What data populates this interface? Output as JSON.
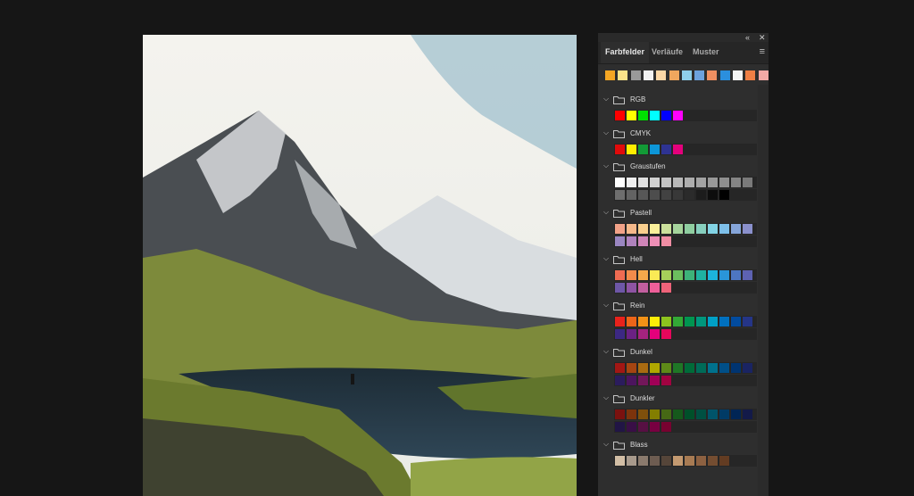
{
  "panel": {
    "collapse_glyph": "«",
    "close_glyph": "✕",
    "menu_glyph": "≡",
    "tabs": [
      {
        "label": "Farbfelder",
        "active": true
      },
      {
        "label": "Verläufe",
        "active": false
      },
      {
        "label": "Muster",
        "active": false
      }
    ],
    "recent": [
      "#f5a623",
      "#fbe38a",
      "#9a9a9a",
      "#f2f2f2",
      "#fbd7a6",
      "#f0a75e",
      "#8ecfea",
      "#6da2de",
      "#f19061",
      "#2b8fde",
      "#f5f5f5",
      "#ef7f45",
      "#f3a9a5"
    ],
    "groups": [
      {
        "name": "RGB",
        "rows": [
          [
            "#ff0000",
            "#ffff00",
            "#00e000",
            "#00ffff",
            "#0000ff",
            "#ff00ff"
          ]
        ]
      },
      {
        "name": "CMYK",
        "rows": [
          [
            "#e10b0b",
            "#ffed00",
            "#129a36",
            "#0d96d8",
            "#2e3393",
            "#e4007c"
          ]
        ]
      },
      {
        "name": "Graustufen",
        "rows": [
          [
            "#ffffff",
            "#f0f0f0",
            "#e0e0e0",
            "#d1d1d1",
            "#c4c4c4",
            "#b8b8b8",
            "#adadad",
            "#a3a3a3",
            "#999999",
            "#8f8f8f",
            "#858585",
            "#7a7a7a"
          ],
          [
            "#6e6e6e",
            "#636363",
            "#575757",
            "#4d4d4d",
            "#424242",
            "#383838",
            "#2b2b2b",
            "#1c1c1c",
            "#0d0d0d",
            "#000000"
          ]
        ]
      },
      {
        "name": "Pastell",
        "rows": [
          [
            "#f2a288",
            "#f6b98a",
            "#f9cf8e",
            "#fbf09a",
            "#cbe09b",
            "#a6d49c",
            "#8fcea0",
            "#87cfbe",
            "#82d3e4",
            "#7ec0ea",
            "#85a5d9",
            "#8a90cc"
          ],
          [
            "#9a86c1",
            "#b083bd",
            "#cf85b8",
            "#ee8fb6",
            "#f08ea4"
          ]
        ]
      },
      {
        "name": "Hell",
        "rows": [
          [
            "#ef6b52",
            "#f28b4b",
            "#f5a84b",
            "#faea55",
            "#a6d05a",
            "#6cbe5e",
            "#3db279",
            "#1fb2a2",
            "#1cb5dd",
            "#2a95d9",
            "#4d76c2",
            "#5d62b2"
          ],
          [
            "#6e57a7",
            "#8e54a3",
            "#c25f9f",
            "#ee5f99",
            "#ee6379"
          ]
        ]
      },
      {
        "name": "Rein",
        "rows": [
          [
            "#e8221c",
            "#ec6519",
            "#f29217",
            "#fdec07",
            "#8dc31e",
            "#33a936",
            "#009550",
            "#00977d",
            "#00a0c6",
            "#0070bf",
            "#024b9e",
            "#253587"
          ],
          [
            "#3c2883",
            "#6b2183",
            "#a5237f",
            "#e4007b",
            "#e7075b"
          ]
        ]
      },
      {
        "name": "Dunkel",
        "rows": [
          [
            "#a31714",
            "#a64511",
            "#a96b11",
            "#b0a700",
            "#5e8a18",
            "#1f7726",
            "#006b39",
            "#006b58",
            "#00718d",
            "#004f88",
            "#003471",
            "#1a2462"
          ],
          [
            "#2b1c5d",
            "#4c155e",
            "#73175a",
            "#a00057",
            "#a10341"
          ]
        ]
      },
      {
        "name": "Dunkler",
        "rows": [
          [
            "#7b110f",
            "#7c330c",
            "#7f500c",
            "#837e00",
            "#466815",
            "#16591c",
            "#00502a",
            "#005042",
            "#00546a",
            "#003b66",
            "#002555",
            "#131a49"
          ],
          [
            "#211545",
            "#390f46",
            "#571043",
            "#780041",
            "#780230"
          ]
        ]
      },
      {
        "name": "Blass",
        "rows": [
          [
            "#d2bea5",
            "#a89a8c",
            "#8a7a6d",
            "#6d5c51",
            "#554539",
            "#c49a71",
            "#a87b53",
            "#8d6141",
            "#744d31",
            "#633c22"
          ]
        ]
      }
    ]
  }
}
